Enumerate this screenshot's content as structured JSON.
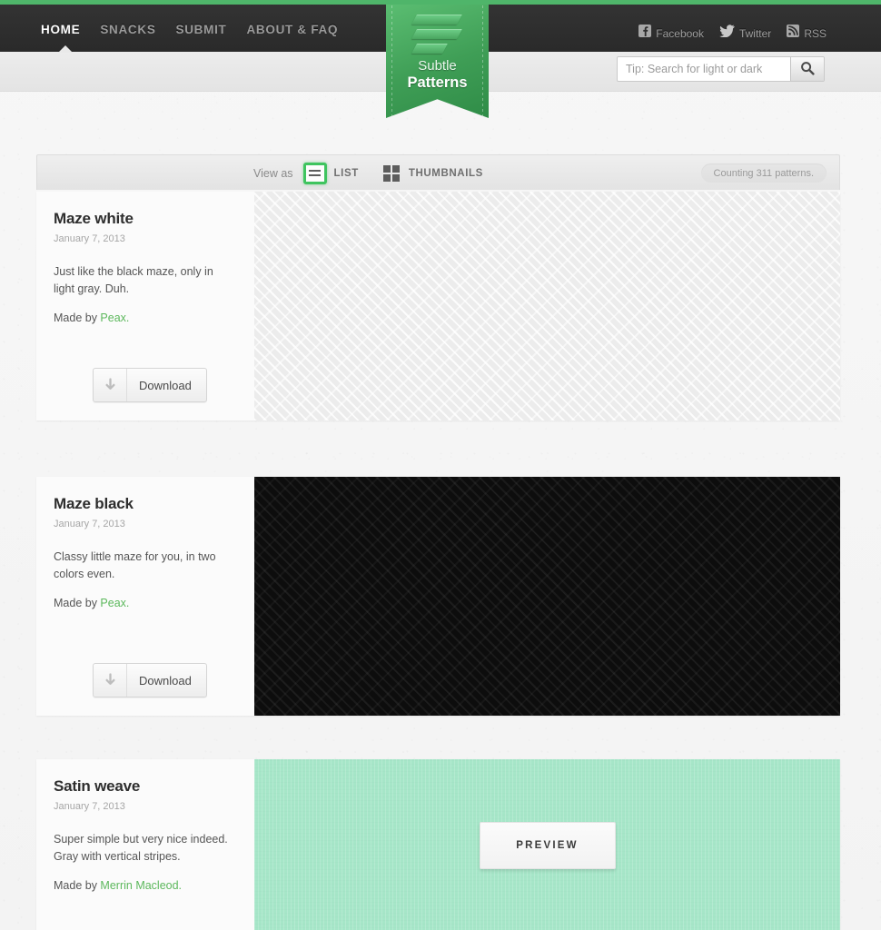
{
  "site": {
    "accent_green": "#4fb56a",
    "link_green": "#5cb85c",
    "nav_bg": "#2e2e2e"
  },
  "logo": {
    "line1": "Subtle",
    "line2": "Patterns",
    "icon": "subtle-patterns-ribbon-logo"
  },
  "nav": {
    "items": [
      {
        "label": "HOME",
        "active": true
      },
      {
        "label": "SNACKS",
        "active": false
      },
      {
        "label": "SUBMIT",
        "active": false
      },
      {
        "label": "ABOUT & FAQ",
        "active": false
      }
    ]
  },
  "social": {
    "items": [
      {
        "label": "Facebook",
        "icon": "facebook-icon"
      },
      {
        "label": "Twitter",
        "icon": "twitter-icon"
      },
      {
        "label": "RSS",
        "icon": "rss-icon"
      }
    ]
  },
  "search": {
    "placeholder": "Tip: Search for light or dark",
    "value": "",
    "button_icon": "search-icon"
  },
  "toolbar": {
    "view_as_label": "View as",
    "views": [
      {
        "label": "LIST",
        "icon": "list-view-icon",
        "active": true
      },
      {
        "label": "THUMBNAILS",
        "icon": "grid-view-icon",
        "active": false
      }
    ],
    "counting": "Counting 311 patterns."
  },
  "download_label": "Download",
  "download_icon": "download-arrow-icon",
  "made_by_label": "Made by ",
  "preview_label": "PREVIEW",
  "patterns": [
    {
      "title": "Maze white",
      "date": "January 7, 2013",
      "description": "Just like the black maze, only in light gray. Duh.",
      "author": "Peax.",
      "style": "maze-light",
      "swatch": "#ececec",
      "has_preview_button": false
    },
    {
      "title": "Maze black",
      "date": "January 7, 2013",
      "description": "Classy little maze for you, in two colors even.",
      "author": "Peax.",
      "style": "maze-dark",
      "swatch": "#0d0d0d",
      "has_preview_button": false
    },
    {
      "title": "Satin weave",
      "date": "January 7, 2013",
      "description": "Super simple but very nice indeed. Gray with vertical stripes.",
      "author": "Merrin Macleod.",
      "style": "satin",
      "swatch": "#a6e6c8",
      "has_preview_button": true
    }
  ]
}
